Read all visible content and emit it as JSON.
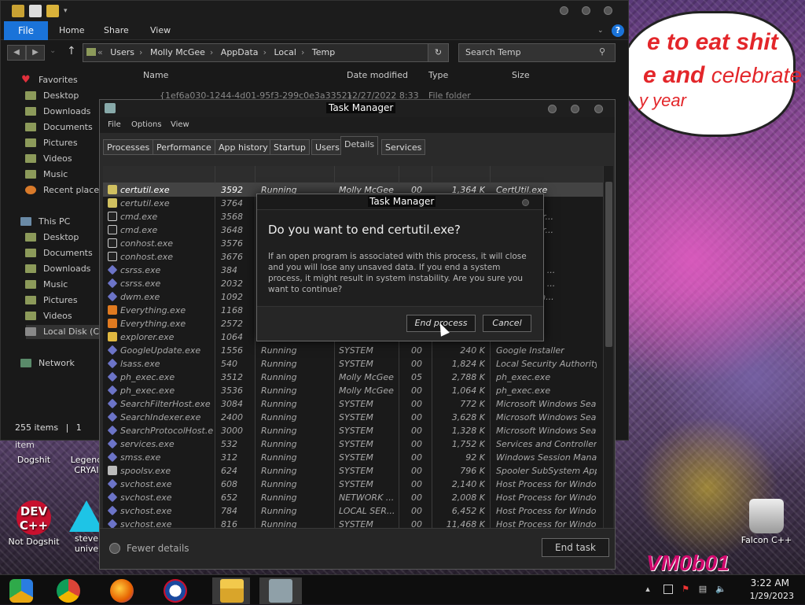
{
  "desktop": {
    "bubble": {
      "line1": "e to eat shit",
      "line2a": "e and",
      "line2b": "celebrate",
      "line3": "y year"
    },
    "watermark": "VM0b01",
    "icons": [
      {
        "label": "Dogshit"
      },
      {
        "label": "Legend CRYAI"
      },
      {
        "label": "Not Dogshit"
      },
      {
        "label": "steve unive"
      },
      {
        "label": "Falcon C++"
      }
    ],
    "dev_icon_text": "DEV C++"
  },
  "explorer": {
    "ribbon_tabs": [
      "File",
      "Home",
      "Share",
      "View"
    ],
    "address": {
      "crumbs": [
        "Users",
        "Molly McGee",
        "AppData",
        "Local",
        "Temp"
      ]
    },
    "search_placeholder": "Search Temp",
    "nav": {
      "favorites": "Favorites",
      "fav_items": [
        "Desktop",
        "Downloads",
        "Documents",
        "Pictures",
        "Videos",
        "Music",
        "Recent places"
      ],
      "this_pc": "This PC",
      "pc_items": [
        "Desktop",
        "Documents",
        "Downloads",
        "Music",
        "Pictures",
        "Videos",
        "Local Disk (C:)"
      ],
      "network": "Network"
    },
    "columns": [
      "Name",
      "Date modified",
      "Type",
      "Size"
    ],
    "first_row": {
      "name": "{1ef6a030-1244-4d01-95f3-299c0e3a3352}",
      "date": "12/27/2022 8:33",
      "type": "File folder"
    },
    "status": {
      "count": "255 items",
      "sep": "|",
      "selected": "1 item"
    }
  },
  "taskmanager": {
    "title": "Task Manager",
    "menu": [
      "File",
      "Options",
      "View"
    ],
    "tabs": [
      "Processes",
      "Performance",
      "App history",
      "Startup",
      "Users",
      "Details",
      "Services"
    ],
    "active_tab": "Details",
    "rows": [
      {
        "name": "certutil.exe",
        "pid": "3592",
        "status": "Running",
        "user": "Molly McGee",
        "cpu": "00",
        "mem": "1,364 K",
        "desc": "CertUtil.exe"
      },
      {
        "name": "certutil.exe",
        "pid": "3764",
        "status": "",
        "user": "",
        "cpu": "",
        "mem": "",
        "desc": ""
      },
      {
        "name": "cmd.exe",
        "pid": "3568",
        "status": "",
        "user": "",
        "cpu": "",
        "mem": "",
        "desc": "ommand Pr..."
      },
      {
        "name": "cmd.exe",
        "pid": "3648",
        "status": "",
        "user": "",
        "cpu": "",
        "mem": "",
        "desc": "ommand Pr..."
      },
      {
        "name": "conhost.exe",
        "pid": "3576",
        "status": "",
        "user": "",
        "cpu": "",
        "mem": "",
        "desc": "ndow Host"
      },
      {
        "name": "conhost.exe",
        "pid": "3676",
        "status": "",
        "user": "",
        "cpu": "",
        "mem": "",
        "desc": "ndow Host"
      },
      {
        "name": "csrss.exe",
        "pid": "384",
        "status": "",
        "user": "",
        "cpu": "",
        "mem": "",
        "desc": "er Runtime ..."
      },
      {
        "name": "csrss.exe",
        "pid": "2032",
        "status": "",
        "user": "",
        "cpu": "",
        "mem": "",
        "desc": "er Runtime ..."
      },
      {
        "name": "dwm.exe",
        "pid": "1092",
        "status": "",
        "user": "",
        "cpu": "",
        "mem": "",
        "desc": "ndow Mana..."
      },
      {
        "name": "Everything.exe",
        "pid": "1168",
        "status": "",
        "user": "",
        "cpu": "",
        "mem": "",
        "desc": ""
      },
      {
        "name": "Everything.exe",
        "pid": "2572",
        "status": "",
        "user": "",
        "cpu": "",
        "mem": "",
        "desc": ""
      },
      {
        "name": "explorer.exe",
        "pid": "1064",
        "status": "",
        "user": "",
        "cpu": "",
        "mem": "",
        "desc": "xplorer"
      },
      {
        "name": "GoogleUpdate.exe",
        "pid": "1556",
        "status": "Running",
        "user": "SYSTEM",
        "cpu": "00",
        "mem": "240 K",
        "desc": "Google Installer"
      },
      {
        "name": "lsass.exe",
        "pid": "540",
        "status": "Running",
        "user": "SYSTEM",
        "cpu": "00",
        "mem": "1,824 K",
        "desc": "Local Security Authority..."
      },
      {
        "name": "ph_exec.exe",
        "pid": "3512",
        "status": "Running",
        "user": "Molly McGee",
        "cpu": "05",
        "mem": "2,788 K",
        "desc": "ph_exec.exe"
      },
      {
        "name": "ph_exec.exe",
        "pid": "3536",
        "status": "Running",
        "user": "Molly McGee",
        "cpu": "00",
        "mem": "1,064 K",
        "desc": "ph_exec.exe"
      },
      {
        "name": "SearchFilterHost.exe",
        "pid": "3084",
        "status": "Running",
        "user": "SYSTEM",
        "cpu": "00",
        "mem": "772 K",
        "desc": "Microsoft Windows Sea..."
      },
      {
        "name": "SearchIndexer.exe",
        "pid": "2400",
        "status": "Running",
        "user": "SYSTEM",
        "cpu": "00",
        "mem": "3,628 K",
        "desc": "Microsoft Windows Sea..."
      },
      {
        "name": "SearchProtocolHost.exe",
        "pid": "3000",
        "status": "Running",
        "user": "SYSTEM",
        "cpu": "00",
        "mem": "1,328 K",
        "desc": "Microsoft Windows Sea..."
      },
      {
        "name": "services.exe",
        "pid": "532",
        "status": "Running",
        "user": "SYSTEM",
        "cpu": "00",
        "mem": "1,752 K",
        "desc": "Services and Controller ..."
      },
      {
        "name": "smss.exe",
        "pid": "312",
        "status": "Running",
        "user": "SYSTEM",
        "cpu": "00",
        "mem": "92 K",
        "desc": "Windows Session Mana..."
      },
      {
        "name": "spoolsv.exe",
        "pid": "624",
        "status": "Running",
        "user": "SYSTEM",
        "cpu": "00",
        "mem": "796 K",
        "desc": "Spooler SubSystem App"
      },
      {
        "name": "svchost.exe",
        "pid": "608",
        "status": "Running",
        "user": "SYSTEM",
        "cpu": "00",
        "mem": "2,140 K",
        "desc": "Host Process for Windo..."
      },
      {
        "name": "svchost.exe",
        "pid": "652",
        "status": "Running",
        "user": "NETWORK ...",
        "cpu": "00",
        "mem": "2,008 K",
        "desc": "Host Process for Windo..."
      },
      {
        "name": "svchost.exe",
        "pid": "784",
        "status": "Running",
        "user": "LOCAL SER...",
        "cpu": "00",
        "mem": "6,452 K",
        "desc": "Host Process for Windo..."
      },
      {
        "name": "svchost.exe",
        "pid": "816",
        "status": "Running",
        "user": "SYSTEM",
        "cpu": "00",
        "mem": "11,468 K",
        "desc": "Host Process for Windo..."
      }
    ],
    "fewer_details": "Fewer details",
    "end_task": "End task"
  },
  "dialog": {
    "title": "Task Manager",
    "heading": "Do you want to end certutil.exe?",
    "body": "If an open program is associated with this process, it will close and you will lose any unsaved data. If you end a system process, it might result in system instability. Are you sure you want to continue?",
    "end_process": "End process",
    "cancel": "Cancel"
  },
  "taskbar": {
    "apps": [
      "chrome-alt",
      "chrome",
      "firefox",
      "obama",
      "file-explorer",
      "task-manager"
    ],
    "time": "3:22 AM",
    "date": "1/29/2023"
  },
  "colors": {
    "accent": "#1a73d9",
    "selected_row": "#434343"
  }
}
